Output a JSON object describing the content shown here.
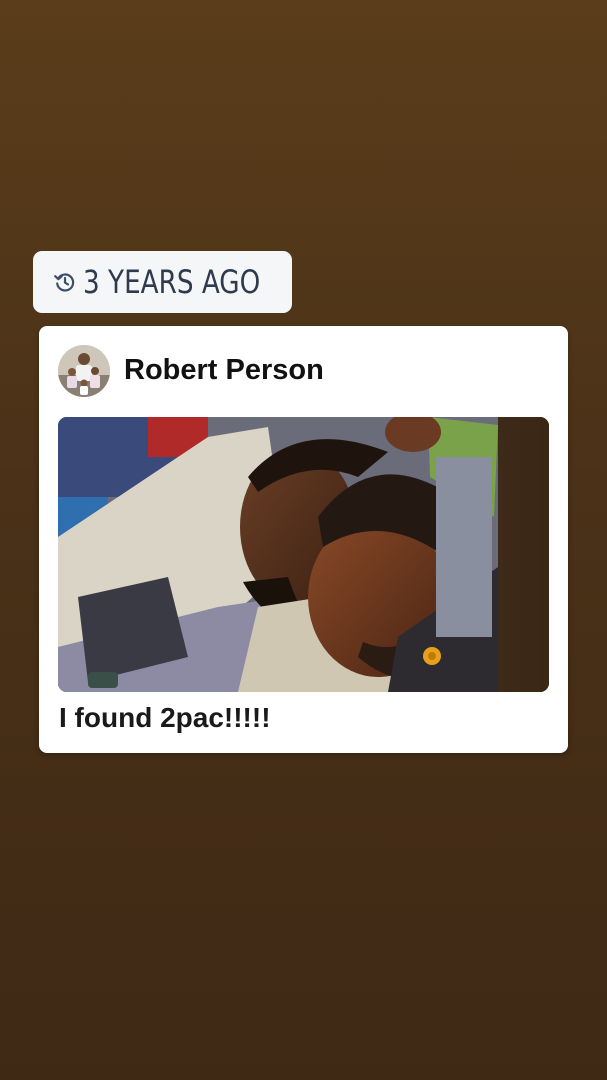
{
  "memory": {
    "icon": "history-icon",
    "label": "3 YEARS AGO"
  },
  "post": {
    "author": "Robert Person",
    "avatar_icon": "profile-photo",
    "photo_description_icon": "photo",
    "caption": "I found 2pac!!!!!"
  },
  "colors": {
    "background_top": "#5a3d1a",
    "background_bottom": "#3f2915",
    "sticker_bg": "#f4f6f8",
    "sticker_text": "#2e3b4e",
    "card_bg": "#ffffff",
    "text_dark": "#111111"
  }
}
